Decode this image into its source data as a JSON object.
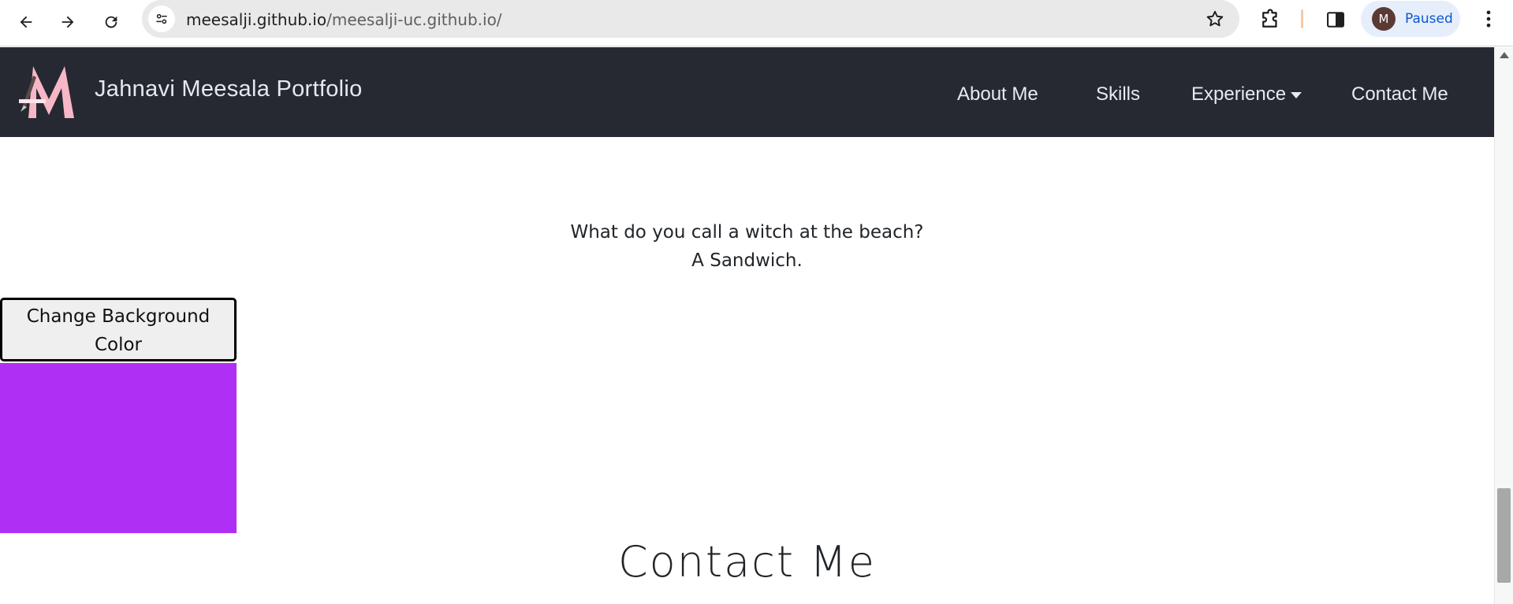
{
  "browser": {
    "url_domain": "meesalji.github.io",
    "url_path": "/meesalji-uc.github.io/",
    "profile_initial": "M",
    "profile_status": "Paused"
  },
  "navbar": {
    "brand": "Jahnavi Meesala Portfolio",
    "links": [
      "About Me",
      "Skills",
      "Experience",
      "Contact Me"
    ]
  },
  "joke": {
    "question": "What do you call a witch at the beach?",
    "answer": "A Sandwich."
  },
  "bg_button": {
    "label": "Change Background Color"
  },
  "color_box": {
    "color": "#b02ff5"
  },
  "contact": {
    "heading": "Contact Me"
  },
  "colors": {
    "navbar": "#262932",
    "logo_pink": "#f7b7c6"
  }
}
